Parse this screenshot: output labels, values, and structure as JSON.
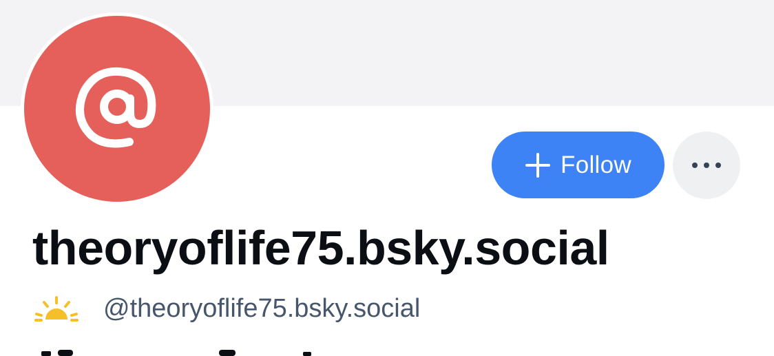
{
  "profile": {
    "display_name": "theoryoflife75.bsky.social",
    "handle": "@theoryoflife75.bsky.social",
    "avatar_icon": "at-sign-icon",
    "status_icon": "sunrise-icon"
  },
  "actions": {
    "follow_label": "Follow",
    "follow_icon": "plus-icon",
    "more_icon": "ellipsis-icon"
  },
  "colors": {
    "banner": "#f3f3f5",
    "avatar_bg": "#e5605a",
    "follow_bg": "#3e83f5",
    "more_bg": "#eef0f2",
    "handle_text": "#47566b",
    "sun": "#f5bf2a"
  }
}
